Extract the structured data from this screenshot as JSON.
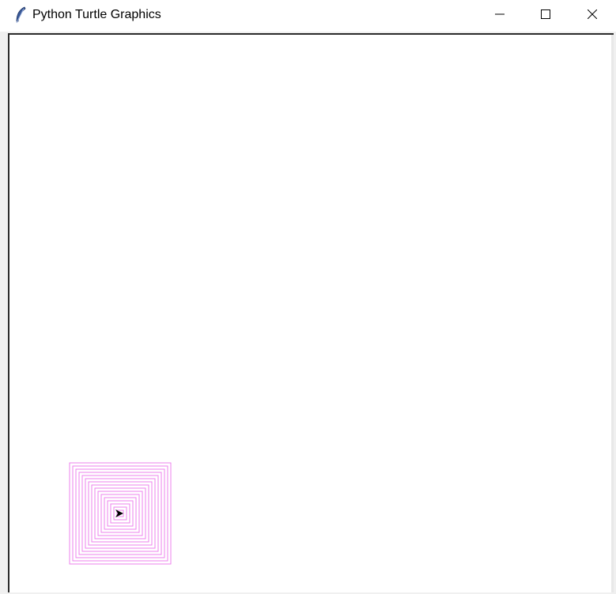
{
  "window": {
    "title": "Python Turtle Graphics",
    "icon": "feather-icon"
  },
  "controls": {
    "minimize_icon": "minimize-icon",
    "maximize_icon": "maximize-icon",
    "close_icon": "close-icon"
  },
  "canvas": {
    "background": "#ffffff",
    "pen_color": "#ee82ee",
    "turtle_color": "#000000",
    "turtle_shape": "arrow-icon"
  }
}
